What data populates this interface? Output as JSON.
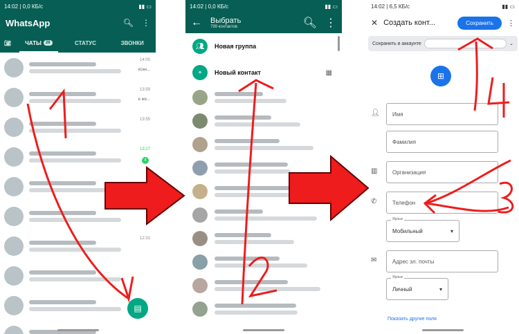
{
  "colors": {
    "wa_green": "#075e54",
    "wa_accent": "#00a884",
    "google_blue": "#1a73e8",
    "arrow_red": "#ee1c1c"
  },
  "whatsapp": {
    "status_time": "14:02",
    "status_info": "0,0 КБ/с",
    "app_title": "WhatsApp",
    "tabs": [
      "ЧАТЫ",
      "СТАТУС",
      "ЗВОНКИ"
    ],
    "chats_badge": "28",
    "chats": [
      {
        "time": "14:00",
        "preview": "ксан..."
      },
      {
        "time": "13:59",
        "preview": "е же..."
      },
      {
        "time": "13:55",
        "preview": ""
      },
      {
        "time": "13:27",
        "preview": "",
        "unread": "4"
      },
      {
        "time": "",
        "preview": ""
      },
      {
        "time": "",
        "preview": ""
      },
      {
        "time": "12:31",
        "preview": ""
      },
      {
        "time": "",
        "preview": ""
      },
      {
        "time": "",
        "preview": ""
      },
      {
        "time": "",
        "preview": ""
      }
    ],
    "annotation": "1"
  },
  "select_contact": {
    "status_time": "14:02",
    "status_info": "0,0 КБ/с",
    "title": "Выбрать",
    "subtitle": "799 контактов",
    "new_group": "Новая группа",
    "new_contact": "Новый контакт",
    "annotation": "2"
  },
  "create_contact": {
    "status_time": "14:02",
    "status_info": "6,5 КБ/с",
    "title": "Создать конт...",
    "save": "Сохранить",
    "account_label": "Сохранить в аккаунте",
    "fields": {
      "name": "Имя",
      "surname": "Фамилия",
      "org": "Организация",
      "phone": "Телефон",
      "label_title": "Ярлык",
      "phone_label": "Мобильный",
      "email": "Адрес эл. почты",
      "email_label": "Личный"
    },
    "more_fields": "Показать другие поля",
    "annotation_3": "3",
    "annotation_4": "4"
  }
}
